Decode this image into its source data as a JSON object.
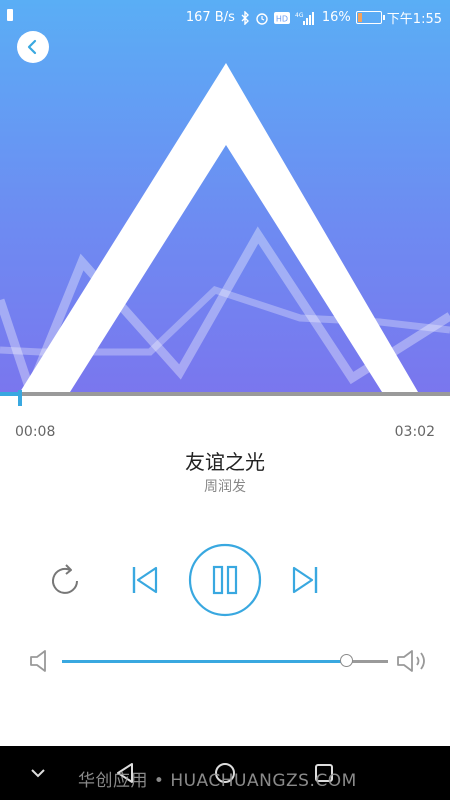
{
  "status_bar": {
    "network_speed": "167 B/s",
    "battery_percent": "16%",
    "battery_level": 0.16,
    "time": "下午1:55",
    "hd_label": "HD",
    "network_type": "4G",
    "icons": [
      "bluetooth-icon",
      "alarm-icon",
      "hd-icon",
      "signal-icon",
      "battery-icon"
    ]
  },
  "header": {
    "back_icon": "chevron-left-icon"
  },
  "player": {
    "progress": 0.044,
    "current_time": "00:08",
    "total_time": "03:02",
    "song_title": "友谊之光",
    "artist": "周润发",
    "state": "playing"
  },
  "controls": {
    "repeat_icon": "repeat-icon",
    "prev_icon": "previous-track-icon",
    "pause_icon": "pause-icon",
    "next_icon": "next-track-icon"
  },
  "volume": {
    "level": 0.87,
    "low_icon": "volume-low-icon",
    "high_icon": "volume-high-icon"
  },
  "nav_bar": {
    "icons": [
      "chevron-down-icon",
      "back-triangle-icon",
      "home-circle-icon",
      "recent-square-icon"
    ]
  },
  "watermark": "华创应用 • HUACHUANGZS.COM",
  "colors": {
    "accent": "#39a8e0",
    "hero_top": "#5aaef5",
    "hero_bottom": "#7a76ee"
  }
}
